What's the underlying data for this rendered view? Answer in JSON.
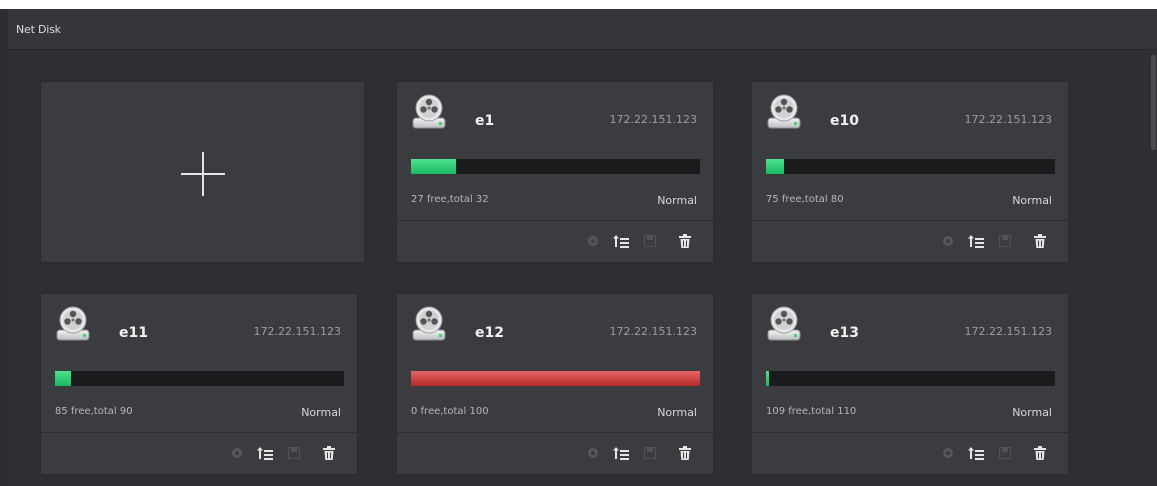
{
  "window": {
    "title": "Net Disk"
  },
  "add_card": {
    "icon": "plus-icon"
  },
  "disks": [
    {
      "name": "e1",
      "ip": "172.22.151.123",
      "free_text": "27 free,total 32",
      "status": "Normal",
      "free": 27,
      "total": 32
    },
    {
      "name": "e10",
      "ip": "172.22.151.123",
      "free_text": "75 free,total 80",
      "status": "Normal",
      "free": 75,
      "total": 80
    },
    {
      "name": "e11",
      "ip": "172.22.151.123",
      "free_text": "85 free,total 90",
      "status": "Normal",
      "free": 85,
      "total": 90
    },
    {
      "name": "e12",
      "ip": "172.22.151.123",
      "free_text": "0 free,total 100",
      "status": "Normal",
      "free": 0,
      "total": 100
    },
    {
      "name": "e13",
      "ip": "172.22.151.123",
      "free_text": "109 free,total 110",
      "status": "Normal",
      "free": 109,
      "total": 110
    }
  ],
  "toolbar_icons": [
    "gear-icon",
    "upload-list-icon",
    "save-icon",
    "trash-icon"
  ],
  "colors": {
    "usage_ok": "#2ecc71",
    "usage_full": "#d04040",
    "bar_background": "#1a1b1d",
    "card_background": "#3a3c40"
  }
}
